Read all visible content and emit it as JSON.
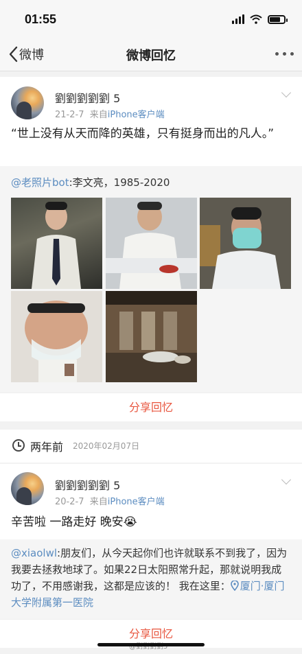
{
  "status_bar": {
    "time": "01:55"
  },
  "nav": {
    "back_label": "微博",
    "title": "微博回忆"
  },
  "posts": [
    {
      "username": "劉劉劉劉劉 5",
      "date": "21-2-7",
      "source_prefix": "来自",
      "source": "iPhone客户端",
      "text": "“世上没有从天而降的英雄，只有挺身而出的凡人。”",
      "repost_mention": "@老照片bot",
      "repost_text": ":李文亮，1985-2020",
      "share_label": "分享回忆"
    },
    {
      "username": "劉劉劉劉劉 5",
      "date": "20-2-7",
      "source_prefix": "来自",
      "source": "iPhone客户端",
      "text": "辛苦啦 一路走好 晚安😭",
      "repost_mention": "@xiaolwl",
      "repost_text": ":朋友们，从今天起你们也许就联系不到我了，因为我要去拯救地球了。如果22日太阳照常升起，那就说明我成功了，不用感谢我，这都是应该的！ 我在这里：",
      "location": "厦门·厦门大学附属第一医院",
      "share_label": "分享回忆"
    }
  ],
  "section": {
    "label": "两年前",
    "date": "2020年02月07日"
  },
  "watermark": "@劉劉劉劉5"
}
